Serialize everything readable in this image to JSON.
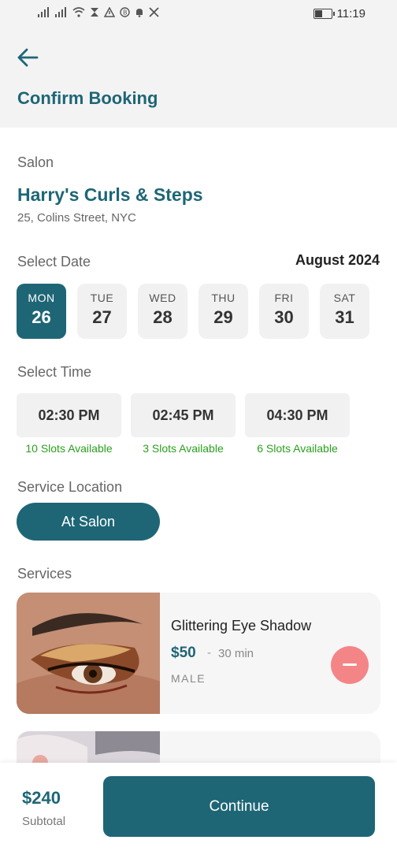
{
  "status_bar": {
    "time": "11:19"
  },
  "header": {
    "title": "Confirm Booking"
  },
  "salon": {
    "label": "Salon",
    "name": "Harry's Curls & Steps",
    "address": "25, Colins Street, NYC"
  },
  "date_section": {
    "label": "Select Date",
    "month": "August 2024",
    "dates": [
      {
        "day": "MON",
        "date": "26",
        "selected": true
      },
      {
        "day": "TUE",
        "date": "27"
      },
      {
        "day": "WED",
        "date": "28"
      },
      {
        "day": "THU",
        "date": "29"
      },
      {
        "day": "FRI",
        "date": "30"
      },
      {
        "day": "SAT",
        "date": "31"
      }
    ]
  },
  "time_section": {
    "label": "Select Time",
    "times": [
      {
        "time": "02:30 PM",
        "slots": "10 Slots Available"
      },
      {
        "time": "02:45 PM",
        "slots": "3 Slots Available"
      },
      {
        "time": "04:30 PM",
        "slots": "6 Slots Available"
      }
    ]
  },
  "location_section": {
    "label": "Service Location",
    "selected": "At Salon"
  },
  "services_section": {
    "label": "Services",
    "items": [
      {
        "name": "Glittering Eye Shadow",
        "price": "$50",
        "separator": "-",
        "duration": "30 min",
        "gender": "MALE"
      }
    ]
  },
  "footer": {
    "subtotal": "$240",
    "subtotal_label": "Subtotal",
    "continue_label": "Continue"
  },
  "colors": {
    "primary": "#1e6676",
    "slots_green": "#2aa01c",
    "remove": "#f48587"
  }
}
